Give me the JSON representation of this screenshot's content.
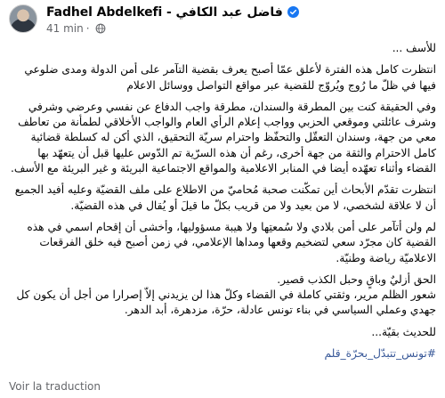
{
  "post": {
    "author": "Fadhel Abdelkefi - فاضل عبد الكافي",
    "time": "41 min",
    "separator": "·",
    "paragraphs": [
      "للأسف ...",
      "انتظرت كامل هذه الفترة لأعلق عمّا أصبح يعرف بقضية التآمر على أمن الدولة ومدى ضلوعي فيها في ظلّ ما رُوج ويُروّج للقضية عبر مواقع التواصل ووسائل الاعلام",
      "وفي الحقيقة كنت بين المطرقة والسندان، مطرقة واجب الدفاع عن نفسي وعرضي وشرفي وشرف عائلتي وموقعي الحزبي وواجب إعلام الرأي العام والواجب الأخلاقي لطمأنة من تعاطف معي من جهة، وسندان التعقّل والتحفّظ واحترام سريّة التحقيق، الذي أكن له كسلطة قضائية كامل الاحترام والثقة من جهة أخرى، رغم أن هذه السرّية تم الدّوس عليها قبل أن يتعهّد بها القضاء وأثناء تعهّده أيضا في المنابر الاعلامية والمواقع الاجتماعية البريئة و غير البريئة مع الأسف.",
      "انتظرت تقدّم الأبحاث أين تمكّنت صحبة مُحاميّ من الاطلاع على ملف القضيّة وعليه أفيد الجميع أن لا علاقة لشخصي، لا من بعيد ولا من قريب بكلّ ما قيلَ أو يُقال في هذه القضيّة.",
      "لم ولن أتآمر على أمن بلادي ولا سُمعتِها ولا هيبة مسؤوليها، وأخشى أن إقحام اسمي في هذه القضية كان مجرّد سعي لتضخيم وقعها ومداها الإعلامي، في زمن أصبح فيه خلق الفرقعات الاعلاميّة رياضة وطنيّة.",
      "الحق أزليٌ وباقٍ وحبل الكذب قصير.\nشعور الظلم مرير، وثقتي كاملة في القضاء وكلّ هذا لن يزيدني إلاّ إصرارا من أجل أن يكون كل جهدي وعملي السياسي في بناء تونس عادلة، حرّة، مزدهرة، أبد الدهر.",
      "للحديث بقيّة..."
    ],
    "hashtag": "#تونس_تتبدّل_بحرّة_قلم",
    "see_translation": "Voir la traduction"
  },
  "colors": {
    "verified_badge": "#1877f2",
    "hashtag": "#385898",
    "meta_text": "#65676b"
  },
  "icons": [
    "avatar",
    "verified-badge-icon",
    "globe-icon"
  ]
}
